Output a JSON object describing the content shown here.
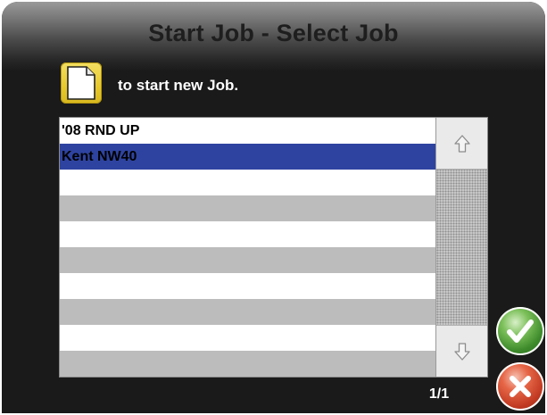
{
  "header": {
    "title": "Start Job - Select Job"
  },
  "new_job": {
    "icon": "new-document-icon",
    "hint": "to start new Job."
  },
  "job_list": {
    "items": [
      "'08 RND UP",
      "Kent NW40",
      "",
      "",
      "",
      "",
      "",
      "",
      "",
      ""
    ],
    "selected": "Kent NW40",
    "scroll_up_icon": "arrow-up-icon",
    "scroll_down_icon": "arrow-down-icon"
  },
  "pagination": {
    "text": "1/1"
  },
  "actions": {
    "accept_icon": "checkmark-icon",
    "cancel_icon": "close-icon"
  },
  "colors": {
    "selection": "#2e43a0",
    "new_job_button": "#e7c92d",
    "accept": "#3d8a2b",
    "cancel": "#c23a22"
  }
}
